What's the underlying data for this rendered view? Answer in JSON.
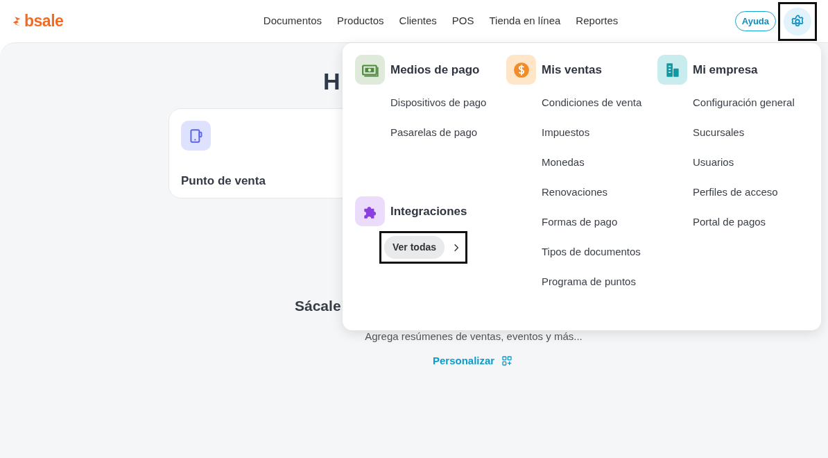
{
  "header": {
    "logo": "bsale",
    "nav": [
      {
        "label": "Documentos"
      },
      {
        "label": "Productos"
      },
      {
        "label": "Clientes"
      },
      {
        "label": "POS"
      },
      {
        "label": "Tienda en línea"
      },
      {
        "label": "Reportes"
      }
    ],
    "help_button": "Ayuda",
    "settings_button": {
      "highlighted": true
    }
  },
  "page": {
    "heading": "H",
    "card": {
      "title": "Punto de venta"
    },
    "section_title": "Sácale",
    "subtitle": "Agrega resúmenes de ventas, eventos y más...",
    "customize_link": "Personalizar"
  },
  "settings_menu": {
    "groups": [
      {
        "kind": "money",
        "title": "Medios de pago",
        "items": [
          "Dispositivos de pago",
          "Pasarelas de pago"
        ]
      },
      {
        "kind": "coin",
        "title": "Mis ventas",
        "items": [
          "Condiciones de venta",
          "Impuestos",
          "Monedas",
          "Renovaciones",
          "Formas de pago",
          "Tipos de documentos",
          "Programa de puntos"
        ]
      },
      {
        "kind": "building",
        "title": "Mi empresa",
        "items": [
          "Configuración general",
          "Sucursales",
          "Usuarios",
          "Perfiles de acceso",
          "Portal de pagos"
        ]
      }
    ],
    "integrations": {
      "kind": "puzzle",
      "title": "Integraciones",
      "button": "Ver todas",
      "highlighted": true
    }
  }
}
